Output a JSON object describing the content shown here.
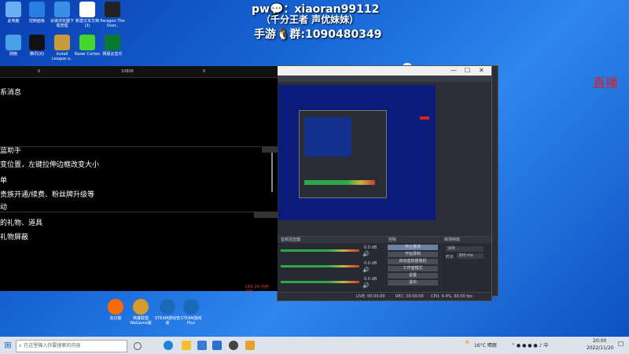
{
  "desktop_icons": [
    {
      "name": "此电脑",
      "label": "此电脑",
      "color": "#6ab0f0"
    },
    {
      "name": "控制面板",
      "label": "控制面板",
      "color": "#2a7de1"
    },
    {
      "name": "谷歌浏览器",
      "label": "谷歌浏览器下载管理",
      "color": "#3a8ee6"
    },
    {
      "name": "新建文本",
      "label": "新建文本文档(3)",
      "color": "#ffffff"
    },
    {
      "name": "paragon",
      "label": "Paragon The Over..",
      "color": "#222222"
    },
    {
      "name": "网络",
      "label": "网络",
      "color": "#4aa0e8"
    },
    {
      "name": "腾讯qq",
      "label": "腾讯QQ",
      "color": "#111111"
    },
    {
      "name": "lol",
      "label": "Install League o..",
      "color": "#c89b3c"
    },
    {
      "name": "razer",
      "label": "Razer Cortex",
      "color": "#44d62c"
    },
    {
      "name": "网易",
      "label": "网易云音乐",
      "color": "#0a7a30"
    }
  ],
  "overlay": {
    "line1": "pw💬：xiaoran99112",
    "line2": "（千分王者 声优妹妹）",
    "line3": "手游🐧群:1090480349"
  },
  "panel": {
    "stats": [
      "0",
      "10808",
      "0"
    ],
    "lines": [
      "系消息",
      "蓝助手",
      "变位置，左键拉伸边框改变大小",
      "单",
      "贵族开通/续费、粉丝牌升级等",
      "动",
      "的礼物、道具",
      "礼物屏蔽"
    ],
    "cpu": "CPU 24 内存 42%"
  },
  "obs": {
    "title_buttons": [
      "—",
      "☐",
      "✕"
    ],
    "dock_headers": [
      "音频混音器",
      "控制",
      "转场特效"
    ],
    "controls": [
      "停止推流",
      "开始录制",
      "启动虚拟摄像机",
      "工作室模式",
      "设置",
      "退出"
    ],
    "transition": "淡出",
    "duration_label": "时长",
    "duration": "300 ms",
    "status": {
      "live": "LIVE: 00:00:00",
      "rec": "REC: 00:00:00",
      "cpu": "CPU: 9.4%, 60.00 fps"
    },
    "meter_vals": [
      "0.0 dB",
      "0.0 dB",
      "0.0 dB"
    ]
  },
  "right_edge_text": "直播",
  "dock_apps": [
    {
      "name": "向日葵",
      "label": "向日葵",
      "color": "#ff6a00"
    },
    {
      "name": "wegame",
      "label": "英雄联盟WeGame版",
      "color": "#d89a2a"
    },
    {
      "name": "steam1",
      "label": "STEAM游戏管家",
      "color": "#1b6ab8"
    },
    {
      "name": "steam2",
      "label": "STEAM游戏Plus",
      "color": "#1b6ab8"
    }
  ],
  "taskbar": {
    "search_placeholder": "在这里输入你要搜索的内容",
    "weather": "16°C 晴朗",
    "time": "20:00",
    "date": "2022/11/20"
  }
}
